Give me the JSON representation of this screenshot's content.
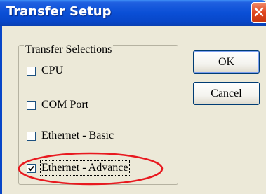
{
  "window": {
    "title": "Transfer Setup"
  },
  "group": {
    "legend": "Transfer Selections",
    "items": [
      {
        "label": "CPU",
        "checked": false
      },
      {
        "label": "COM Port",
        "checked": false
      },
      {
        "label": "Ethernet - Basic",
        "checked": false
      },
      {
        "label": "Ethernet - Advance",
        "checked": true
      }
    ]
  },
  "buttons": {
    "ok": "OK",
    "cancel": "Cancel"
  },
  "colors": {
    "highlight": "#e8191f",
    "titlebar": "#0a4fd6"
  }
}
